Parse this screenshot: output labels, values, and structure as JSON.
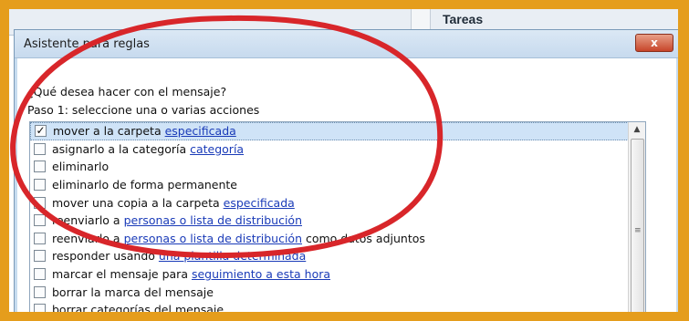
{
  "background": {
    "tasks_header": "Tareas"
  },
  "dialog": {
    "title": "Asistente para reglas",
    "close_label": "x",
    "question": "¿Qué desea hacer con el mensaje?",
    "step_label": "Paso 1: seleccione una o varias acciones"
  },
  "actions": [
    {
      "checked": true,
      "parts": [
        {
          "text": "mover a la carpeta ",
          "link": false
        },
        {
          "text": "especificada",
          "link": true
        }
      ]
    },
    {
      "checked": false,
      "parts": [
        {
          "text": "asignarlo a la categoría ",
          "link": false
        },
        {
          "text": "categoría",
          "link": true
        }
      ]
    },
    {
      "checked": false,
      "parts": [
        {
          "text": "eliminarlo",
          "link": false
        }
      ]
    },
    {
      "checked": false,
      "parts": [
        {
          "text": "eliminarlo de forma permanente",
          "link": false
        }
      ]
    },
    {
      "checked": false,
      "parts": [
        {
          "text": "mover una copia a la carpeta ",
          "link": false
        },
        {
          "text": "especificada",
          "link": true
        }
      ]
    },
    {
      "checked": false,
      "parts": [
        {
          "text": "reenviarlo a ",
          "link": false
        },
        {
          "text": "personas o lista de distribución",
          "link": true
        }
      ]
    },
    {
      "checked": false,
      "parts": [
        {
          "text": "reenviarlo a ",
          "link": false
        },
        {
          "text": "personas o lista de distribución",
          "link": true
        },
        {
          "text": " como datos adjuntos",
          "link": false
        }
      ]
    },
    {
      "checked": false,
      "parts": [
        {
          "text": "responder usando ",
          "link": false
        },
        {
          "text": "una plantilla determinada",
          "link": true
        }
      ]
    },
    {
      "checked": false,
      "parts": [
        {
          "text": "marcar el mensaje para ",
          "link": false
        },
        {
          "text": "seguimiento a esta hora",
          "link": true
        }
      ]
    },
    {
      "checked": false,
      "parts": [
        {
          "text": "borrar la marca del mensaje",
          "link": false
        }
      ]
    },
    {
      "checked": false,
      "parts": [
        {
          "text": "borrar categorías del mensaje",
          "link": false
        }
      ]
    }
  ],
  "colors": {
    "frame": "#e59d1c",
    "link": "#1a3bb8",
    "selection": "#cfe3f7",
    "annotation": "#d8262a"
  },
  "icons": {
    "scroll_up": "chevron-up-icon",
    "checkmark": "checkmark-icon",
    "close": "close-icon"
  }
}
